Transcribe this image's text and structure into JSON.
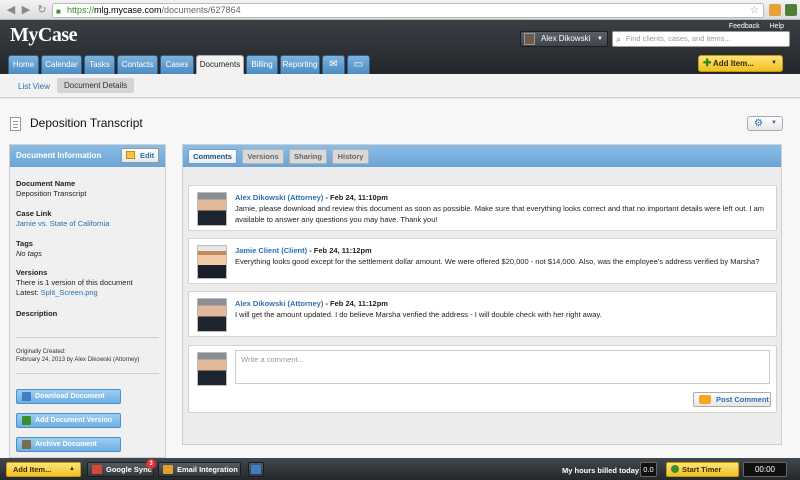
{
  "browser": {
    "url_scheme": "https://",
    "url_host": "mlg.mycase.com",
    "url_path": "/documents/627864"
  },
  "header": {
    "logo": "MyCase",
    "feedback": "Feedback",
    "help": "Help",
    "user_name": "Alex Dikowski",
    "search_placeholder": "Find clients, cases, and items...",
    "add_item": "Add Item...",
    "tabs": [
      {
        "label": "Home"
      },
      {
        "label": "Calendar"
      },
      {
        "label": "Tasks"
      },
      {
        "label": "Contacts"
      },
      {
        "label": "Cases"
      },
      {
        "label": "Documents"
      },
      {
        "label": "Billing"
      },
      {
        "label": "Reporting"
      }
    ],
    "active_tab": "Documents"
  },
  "subnav": {
    "list_view": "List View",
    "current": "Document Details"
  },
  "document": {
    "title": "Deposition Transcript"
  },
  "info_panel": {
    "title": "Document Information",
    "edit": "Edit",
    "name_label": "Document Name",
    "name_value": "Deposition Transcript",
    "case_label": "Case Link",
    "case_value": "Jamie vs. State of California",
    "tags_label": "Tags",
    "tags_value": "No tags",
    "versions_label": "Versions",
    "versions_value": "There is 1 version of this document",
    "latest_label": "Latest:",
    "latest_value": "Split_Screen.png",
    "description_label": "Description",
    "created_label": "Originally Created:",
    "created_value": "February 24, 2013 by Alex Dikowski (Attorney)",
    "download": "Download Document",
    "add_version": "Add Document Version",
    "archive": "Archive Document"
  },
  "main_tabs": [
    {
      "label": "Comments"
    },
    {
      "label": "Versions"
    },
    {
      "label": "Sharing"
    },
    {
      "label": "History"
    }
  ],
  "comments": [
    {
      "author": "Alex Dikowski (Attorney)",
      "date": " - Feb 24, 11:10pm",
      "text": "Jamie, please download and review this document as soon as possible. Make sure that everything looks correct and that no important details were left out. I am available to answer any questions you may have. Thank you!"
    },
    {
      "author": "Jamie Client (Client)",
      "date": " - Feb 24, 11:12pm",
      "text": "Everything looks good except for the settlement dollar amount. We were offered $20,000 - not $14,000. Also, was the employee's address verified by Marsha?"
    },
    {
      "author": "Alex Dikowski (Attorney)",
      "date": " - Feb 24, 11:12pm",
      "text": "I will get the amount updated. I do believe Marsha verified the address - I will double check with her right away."
    }
  ],
  "new_comment": {
    "placeholder": "Write a comment...",
    "post": "Post Comment"
  },
  "bottombar": {
    "add_item": "Add Item...",
    "google_sync": "Google Sync",
    "google_sync_badge": "3",
    "email_integration": "Email Integration",
    "hours_label": "My hours billed today:",
    "hours_value": "0.0",
    "start_timer": "Start Timer",
    "timer_value": "00:00"
  },
  "colors": {
    "accent_blue": "#6aa4d6",
    "link_blue": "#2c6fb3",
    "add_yellow": "#f0c020",
    "header_dark": "#23272b"
  }
}
